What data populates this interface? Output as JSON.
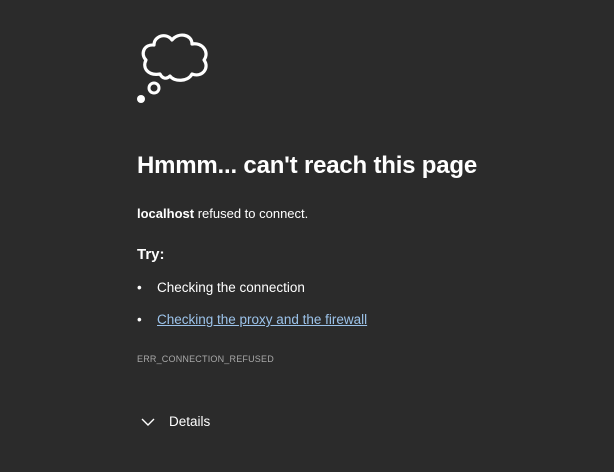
{
  "error_page": {
    "title": "Hmmm... can't reach this page",
    "host": "localhost",
    "host_message": " refused to connect.",
    "try_label": "Try:",
    "suggestions": [
      {
        "text": "Checking the connection",
        "is_link": false
      },
      {
        "text": "Checking the proxy and the firewall",
        "is_link": true
      }
    ],
    "error_code": "ERR_CONNECTION_REFUSED",
    "details_label": "Details"
  },
  "icons": {
    "main": "cloud-thought-icon",
    "details": "chevron-down-icon"
  },
  "colors": {
    "background": "#2b2b2b",
    "text": "#ffffff",
    "link": "#9cc3ea",
    "muted": "#a8a8a8"
  }
}
